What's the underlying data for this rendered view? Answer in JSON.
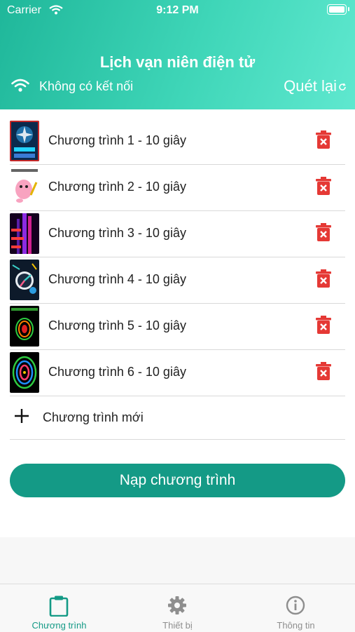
{
  "status_bar": {
    "carrier": "Carrier",
    "time": "9:12 PM"
  },
  "header": {
    "title": "Lịch vạn niên điện tử",
    "connection_text": "Không có kết nối",
    "rescan_label": "Quét lại"
  },
  "programs": [
    {
      "label": "Chương trình 1 - 10 giây"
    },
    {
      "label": "Chương trình 2 - 10 giây"
    },
    {
      "label": "Chương trình 3 - 10 giây"
    },
    {
      "label": "Chương trình 4 - 10 giây"
    },
    {
      "label": "Chương trình 5 - 10 giây"
    },
    {
      "label": "Chương trình 6 - 10 giây"
    }
  ],
  "new_program_label": "Chương trình mới",
  "load_button_label": "Nạp chương trình",
  "tabs": [
    {
      "label": "Chương trình",
      "icon": "clipboard-icon",
      "active": true
    },
    {
      "label": "Thiết bị",
      "icon": "gear-icon",
      "active": false
    },
    {
      "label": "Thông tin",
      "icon": "info-icon",
      "active": false
    }
  ],
  "colors": {
    "accent": "#149a86",
    "delete": "#e53935",
    "header_start": "#1fb79a",
    "header_end": "#5fe8cf"
  }
}
